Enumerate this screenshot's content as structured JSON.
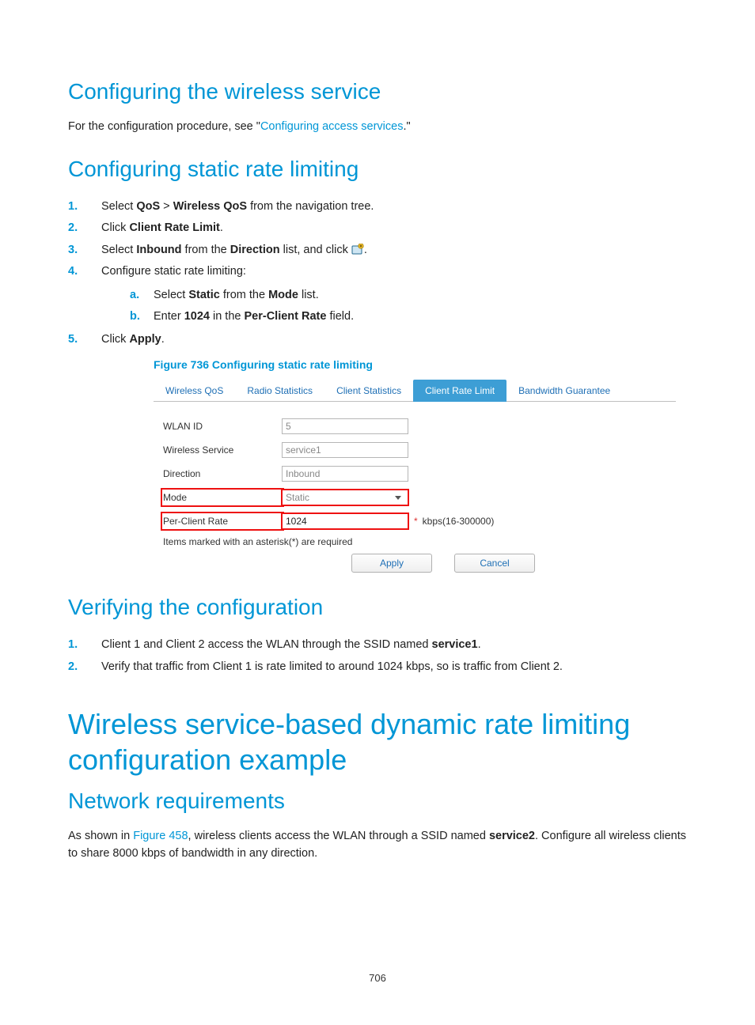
{
  "page_number": "706",
  "s1": {
    "heading": "Configuring the wireless service",
    "para_pre": "For the configuration procedure, see \"",
    "para_link": "Configuring access services",
    "para_post": ".\""
  },
  "s2": {
    "heading": "Configuring static rate limiting",
    "steps": {
      "m1": "1.",
      "t1a": "Select ",
      "t1b": "QoS",
      "t1c": " > ",
      "t1d": "Wireless QoS",
      "t1e": " from the navigation tree.",
      "m2": "2.",
      "t2a": "Click ",
      "t2b": "Client Rate Limit",
      "t2c": ".",
      "m3": "3.",
      "t3a": "Select ",
      "t3b": "Inbound",
      "t3c": " from the ",
      "t3d": "Direction",
      "t3e": " list, and click ",
      "t3f": ".",
      "m4": "4.",
      "t4": "Configure static rate limiting:",
      "sa_m": "a.",
      "sa_a": "Select ",
      "sa_b": "Static",
      "sa_c": " from the ",
      "sa_d": "Mode",
      "sa_e": " list.",
      "sb_m": "b.",
      "sb_a": "Enter ",
      "sb_b": "1024",
      "sb_c": " in the ",
      "sb_d": "Per-Client Rate",
      "sb_e": " field.",
      "m5": "5.",
      "t5a": "Click ",
      "t5b": "Apply",
      "t5c": "."
    },
    "figcap": "Figure 736 Configuring static rate limiting"
  },
  "fig": {
    "tabs": [
      "Wireless QoS",
      "Radio Statistics",
      "Client Statistics",
      "Client Rate Limit",
      "Bandwidth Guarantee"
    ],
    "active_tab_index": 3,
    "rows": {
      "wlan_label": "WLAN ID",
      "wlan_value": "5",
      "svc_label": "Wireless Service",
      "svc_value": "service1",
      "dir_label": "Direction",
      "dir_value": "Inbound",
      "mode_label": "Mode",
      "mode_value": "Static",
      "rate_label": "Per-Client Rate",
      "rate_value": "1024",
      "rate_req": "*",
      "rate_suffix": "kbps(16-300000)"
    },
    "note": "Items marked with an asterisk(*) are required",
    "apply": "Apply",
    "cancel": "Cancel"
  },
  "s3": {
    "heading": "Verifying the configuration",
    "m1": "1.",
    "t1a": "Client 1 and Client 2 access the WLAN through the SSID named ",
    "t1b": "service1",
    "t1c": ".",
    "m2": "2.",
    "t2": "Verify that traffic from Client 1 is rate limited to around 1024 kbps, so is traffic from Client 2."
  },
  "s4": {
    "heading": "Wireless service-based dynamic rate limiting configuration example"
  },
  "s5": {
    "heading": "Network requirements",
    "p1a": "As shown in ",
    "p1link": "Figure 458",
    "p1b": ", wireless clients access the WLAN through a SSID named ",
    "p1c": "service2",
    "p1d": ". Configure all wireless clients to share 8000 kbps of bandwidth in any direction."
  }
}
